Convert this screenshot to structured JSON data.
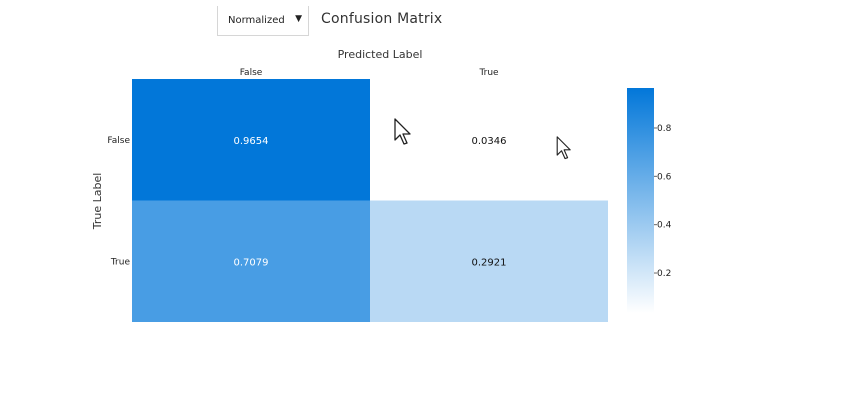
{
  "controls": {
    "normalization_select": {
      "selected": "Normalized"
    }
  },
  "chart_data": {
    "type": "heatmap",
    "title": "Confusion Matrix",
    "xlabel": "Predicted Label",
    "ylabel": "True Label",
    "x_categories": [
      "False",
      "True"
    ],
    "y_categories": [
      "False",
      "True"
    ],
    "values": [
      [
        0.9654,
        0.0346
      ],
      [
        0.7079,
        0.2921
      ]
    ],
    "value_labels": [
      [
        "0.9654",
        "0.0346"
      ],
      [
        "0.7079",
        "0.2921"
      ]
    ],
    "colorbar": {
      "range": [
        0.0346,
        0.9654
      ],
      "ticks": [
        0.2,
        0.4,
        0.6,
        0.8
      ],
      "tick_labels": [
        "0.2",
        "0.4",
        "0.6",
        "0.8"
      ],
      "color_low": "#ffffff",
      "color_high": "#0277d9"
    },
    "text_color_dark_cell": "#ffffff",
    "text_color_light_cell": "#111111"
  }
}
